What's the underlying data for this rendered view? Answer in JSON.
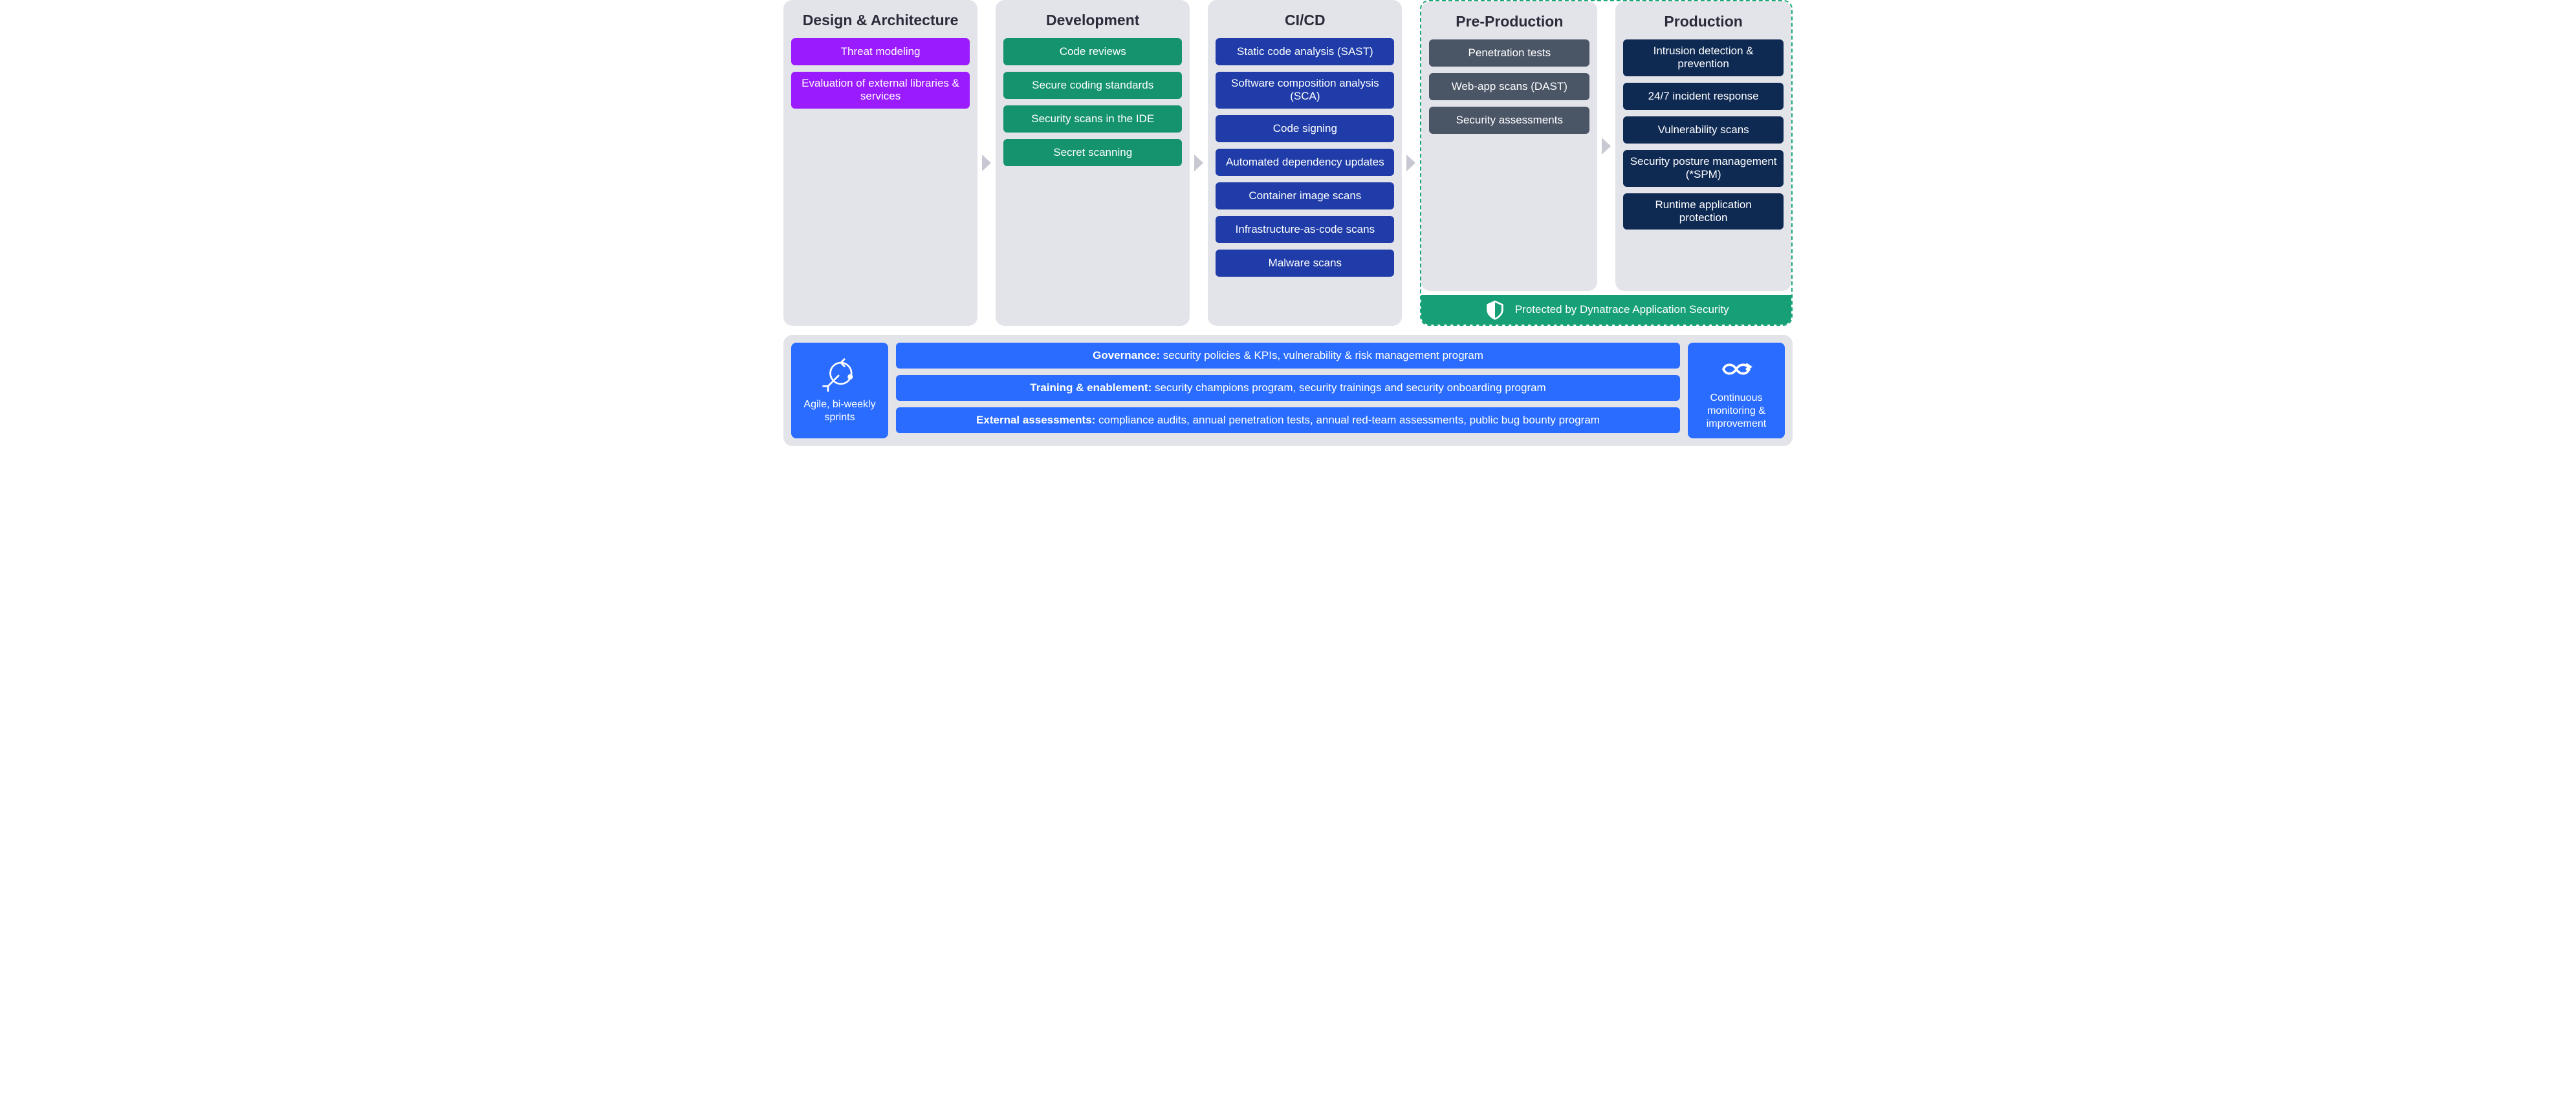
{
  "stages": [
    {
      "title": "Design & Architecture",
      "color": "purple",
      "items": [
        "Threat modeling",
        "Evaluation of external libraries & services"
      ]
    },
    {
      "title": "Development",
      "color": "green",
      "items": [
        "Code reviews",
        "Secure coding standards",
        "Security scans in the IDE",
        "Secret scanning"
      ]
    },
    {
      "title": "CI/CD",
      "color": "blue",
      "items": [
        "Static code analysis (SAST)",
        "Software composition analysis (SCA)",
        "Code signing",
        "Automated dependency updates",
        "Container image scans",
        "Infrastructure-as-code scans",
        "Malware scans"
      ]
    },
    {
      "title": "Pre-Production",
      "color": "slate",
      "items": [
        "Penetration tests",
        "Web-app scans (DAST)",
        "Security assessments"
      ]
    },
    {
      "title": "Production",
      "color": "navy",
      "items": [
        "Intrusion detection & prevention",
        "24/7 incident response",
        "Vulnerability scans",
        "Security posture management (*SPM)",
        "Runtime application protection"
      ]
    }
  ],
  "protected_banner": "Protected by Dynatrace Application Security",
  "bottom": {
    "left": "Agile, bi-weekly sprints",
    "right": "Continuous monitoring & improvement",
    "bars": [
      {
        "label": "Governance:",
        "text": " security policies & KPIs, vulnerability & risk management program"
      },
      {
        "label": "Training & enablement:",
        "text": " security champions program, security trainings and security onboarding program"
      },
      {
        "label": "External assessments:",
        "text": " compliance audits, annual penetration tests, annual red-team assessments, public bug bounty program"
      }
    ]
  }
}
